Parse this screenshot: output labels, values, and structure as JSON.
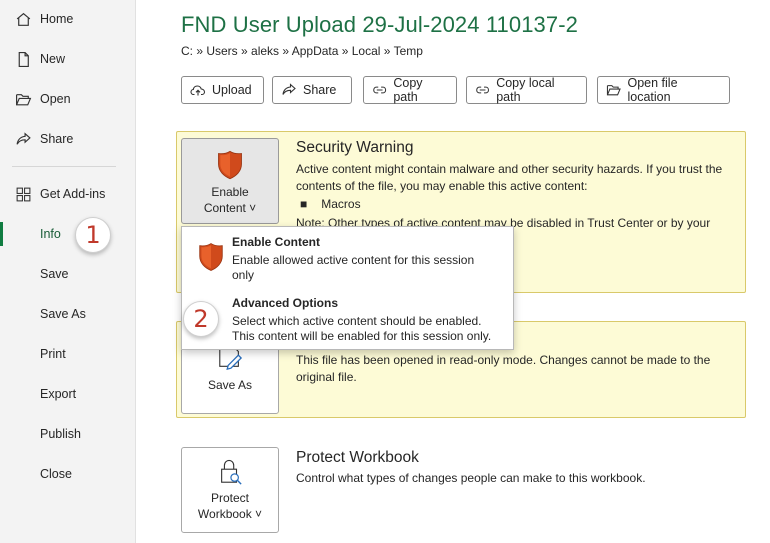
{
  "sidebar": {
    "items": [
      {
        "label": "Home",
        "icon": "home-icon"
      },
      {
        "label": "New",
        "icon": "new-document-icon"
      },
      {
        "label": "Open",
        "icon": "folder-open-icon"
      },
      {
        "label": "Share",
        "icon": "share-icon"
      },
      {
        "label": "Get Add-ins",
        "icon": "grid-icon"
      },
      {
        "label": "Info"
      },
      {
        "label": "Save"
      },
      {
        "label": "Save As"
      },
      {
        "label": "Print"
      },
      {
        "label": "Export"
      },
      {
        "label": "Publish"
      },
      {
        "label": "Close"
      }
    ],
    "active": "Info"
  },
  "callouts": [
    "1",
    "2"
  ],
  "header": {
    "title": "FND User Upload 29-Jul-2024 110137-2",
    "breadcrumb": "C: » Users » aleks » AppData » Local » Temp"
  },
  "toolbar": {
    "upload": "Upload",
    "share": "Share",
    "copy_path": "Copy path",
    "copy_local_path": "Copy local path",
    "open_file_location": "Open file location"
  },
  "security": {
    "button_line1": "Enable",
    "button_line2": "Content ˅",
    "title": "Security Warning",
    "text": "Active content might contain malware and other security hazards. If you trust the contents of the file, you may enable this active content:",
    "bullet": "Macros",
    "note": "Note: Other types of active content may be disabled in Trust Center or by your"
  },
  "dropdown": {
    "enable_title": "Enable Content",
    "enable_desc": "Enable allowed active content for this session only",
    "advanced_title": "Advanced Options",
    "advanced_desc_1": "Select which active content should be enabled.",
    "advanced_desc_2": "This content will be enabled for this session only."
  },
  "readonly": {
    "button": "Save As",
    "text": "This file has been opened in read-only mode. Changes cannot be made to the original file."
  },
  "protect": {
    "button_line1": "Protect",
    "button_line2": "Workbook ˅",
    "title": "Protect Workbook",
    "text": "Control what types of changes people can make to this workbook."
  },
  "colors": {
    "accent_green": "#1e7145",
    "warning_panel": "#fdfbd6",
    "shield_orange": "#d04a1c",
    "callout_red": "#c0392b"
  }
}
